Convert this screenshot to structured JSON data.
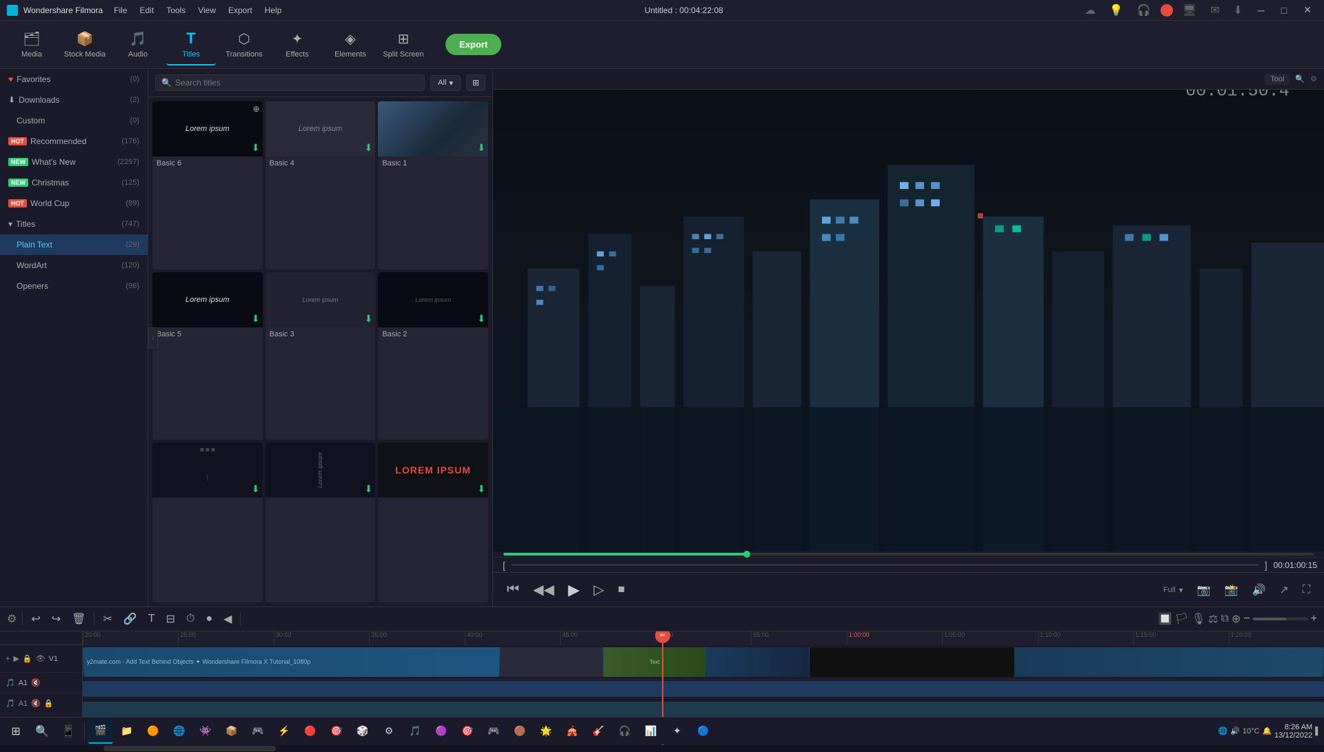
{
  "app": {
    "name": "Wondershare Filmora",
    "title": "Untitled : 00:04:22:08",
    "icon": "🎬"
  },
  "menubar": {
    "items": [
      "File",
      "Edit",
      "Tools",
      "View",
      "Export",
      "Help"
    ]
  },
  "titlebar": {
    "controls": [
      "─",
      "□",
      "✕"
    ]
  },
  "toolbar": {
    "items": [
      {
        "id": "media",
        "icon": "🗂",
        "label": "Media"
      },
      {
        "id": "stock",
        "icon": "📦",
        "label": "Stock Media"
      },
      {
        "id": "audio",
        "icon": "🎵",
        "label": "Audio"
      },
      {
        "id": "titles",
        "icon": "T",
        "label": "Titles",
        "active": true
      },
      {
        "id": "transitions",
        "icon": "⬡",
        "label": "Transitions"
      },
      {
        "id": "effects",
        "icon": "✦",
        "label": "Effects"
      },
      {
        "id": "elements",
        "icon": "◈",
        "label": "Elements"
      },
      {
        "id": "split",
        "icon": "⊞",
        "label": "Split Screen"
      }
    ],
    "export_label": "Export"
  },
  "sidebar": {
    "items": [
      {
        "id": "favorites",
        "label": "Favorites",
        "count": "(0)",
        "indent": false,
        "icon": "♥"
      },
      {
        "id": "downloads",
        "label": "Downloads",
        "count": "(2)",
        "indent": false,
        "icon": "⬇"
      },
      {
        "id": "custom",
        "label": "Custom",
        "count": "(0)",
        "indent": true,
        "icon": ""
      },
      {
        "id": "recommended",
        "label": "Recommended",
        "count": "(176)",
        "indent": false,
        "badge": "HOT"
      },
      {
        "id": "whatsnew",
        "label": "What's New",
        "count": "(2297)",
        "indent": false,
        "badge": "NEW"
      },
      {
        "id": "christmas",
        "label": "Christmas",
        "count": "(125)",
        "indent": false,
        "badge": "NEW"
      },
      {
        "id": "worldcup",
        "label": "World Cup",
        "count": "(89)",
        "indent": false,
        "badge": "HOT"
      },
      {
        "id": "titles",
        "label": "Titles",
        "count": "(747)",
        "indent": false,
        "expanded": true
      },
      {
        "id": "plaintext",
        "label": "Plain Text",
        "count": "(29)",
        "indent": true,
        "active": true
      },
      {
        "id": "wordart",
        "label": "WordArt",
        "count": "(120)",
        "indent": true
      },
      {
        "id": "openers",
        "label": "Openers",
        "count": "(96)",
        "indent": true
      }
    ]
  },
  "content": {
    "search_placeholder": "Search titles",
    "filter_label": "All",
    "cards": [
      {
        "id": "basic6",
        "label": "Basic 6",
        "thumb_type": "dark",
        "has_text": true,
        "text": "Lorem ipsum",
        "has_download": true
      },
      {
        "id": "basic4",
        "label": "Basic 4",
        "thumb_type": "medium",
        "has_text": true,
        "text": "Lorem ipsum",
        "has_download": true
      },
      {
        "id": "basic1",
        "label": "Basic 1",
        "thumb_type": "photo",
        "has_text": false,
        "has_download": true
      },
      {
        "id": "basic5",
        "label": "Basic 5",
        "thumb_type": "dark",
        "has_text": true,
        "text": "Lorem ipsum",
        "has_download": true
      },
      {
        "id": "basic3",
        "label": "Basic 3",
        "thumb_type": "medium",
        "has_text": true,
        "text": "Lorem ipsum",
        "has_download": true
      },
      {
        "id": "basic2",
        "label": "Basic 2",
        "thumb_type": "dark",
        "has_text": true,
        "text": "Lorem ipsum",
        "has_download": true
      },
      {
        "id": "card7",
        "label": "",
        "thumb_type": "dark",
        "has_text": false,
        "has_download": true
      },
      {
        "id": "card8",
        "label": "",
        "thumb_type": "dark",
        "has_text": true,
        "text": "Lorem ipsum",
        "has_download": true
      },
      {
        "id": "card9",
        "label": "",
        "thumb_type": "lorembig",
        "has_text": true,
        "text": "LOREM IPSUM",
        "has_download": true
      }
    ]
  },
  "preview": {
    "time": "00:01:00:15",
    "zoom_label": "Full",
    "in_marker": "[",
    "out_marker": "]"
  },
  "timeline": {
    "markers": [
      "00:00:20:00",
      "00:00:25:00",
      "00:00:30:00",
      "00:00:35:00",
      "00:00:40:00",
      "00:00:45:00",
      "00:00:50:00",
      "00:00:55:00",
      "00:01:00:00",
      "00:01:05:00",
      "00:01:10:00",
      "00:01:15:00",
      "00:01:20:00"
    ],
    "tracks": [
      {
        "id": "v1",
        "type": "video",
        "label": "V1",
        "icons": [
          "▶",
          "🔇",
          "📷",
          "🔒"
        ]
      },
      {
        "id": "a1",
        "type": "audio",
        "label": "A1",
        "icons": [
          "♪",
          "🔇",
          "🔒"
        ]
      }
    ]
  },
  "taskbar": {
    "time": "8:26 AM",
    "date": "13/12/2022",
    "apps": [
      "⊞",
      "🔍",
      "📱",
      "📁",
      "🟠",
      "🟢",
      "🌐",
      "👾",
      "📦",
      "🎮",
      "⚡",
      "🔴",
      "🎯",
      "🎲",
      "⚙",
      "🎵",
      "🟣",
      "🎯",
      "🎮",
      "🟤",
      "🌟",
      "🎪",
      "🎸",
      "🎧",
      "📊",
      "✦",
      "🔵"
    ]
  }
}
